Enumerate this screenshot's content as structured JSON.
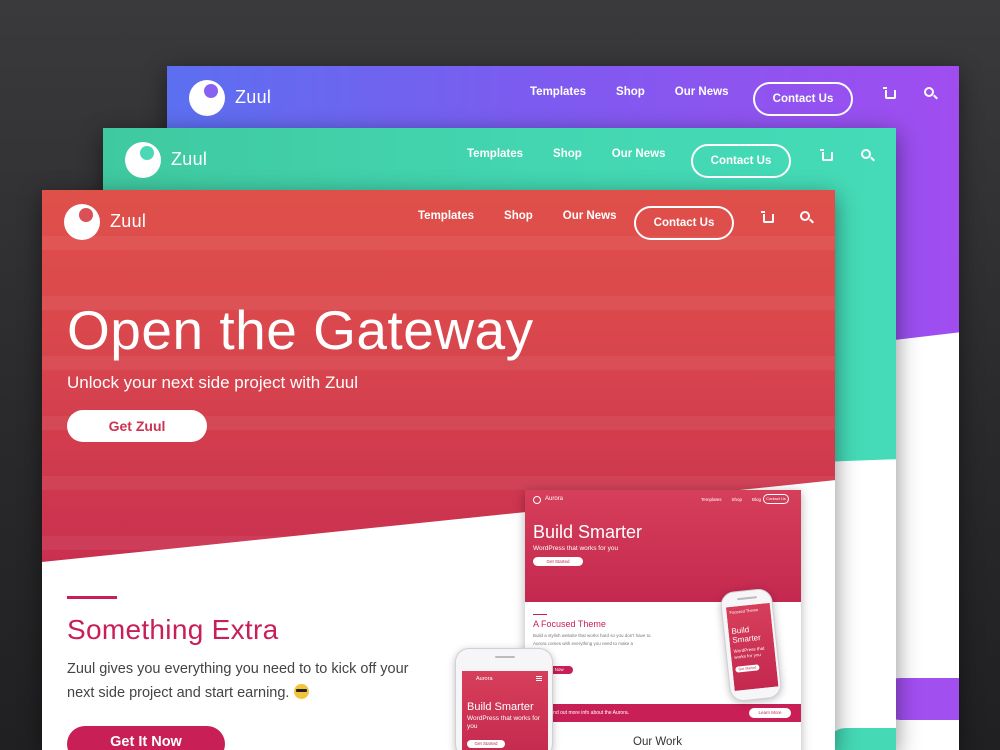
{
  "cards": {
    "purple": {
      "brand": "Zuul",
      "nav": [
        "Templates",
        "Shop",
        "Our News"
      ],
      "contact": "Contact Us",
      "accent": "#7f5af0"
    },
    "green": {
      "brand": "Zuul",
      "nav": [
        "Templates",
        "Shop",
        "Our News"
      ],
      "contact": "Contact Us",
      "accent": "#43d6b1"
    },
    "red": {
      "brand": "Zuul",
      "nav": [
        "Templates",
        "Shop",
        "Our News"
      ],
      "contact": "Contact Us",
      "accent": "#c81f56",
      "hero_title": "Open the Gateway",
      "hero_subtitle": "Unlock your next side project with Zuul",
      "hero_button": "Get Zuul",
      "section_title": "Something Extra",
      "section_text": "Zuul gives you everything you need to to kick off your next side project and start earning.",
      "cta_button": "Get It Now"
    }
  },
  "icons": {
    "cart": "cart-icon",
    "search": "search-icon",
    "emoji": "sunglasses-emoji-icon",
    "logo": "zuul-logo-icon"
  },
  "mockup": {
    "brand": "Aurora",
    "nav": [
      "Templates",
      "Shop",
      "Blog"
    ],
    "contact": "Contact Us",
    "hero_title": "Build Smarter",
    "hero_subtitle": "WordPress that works for you",
    "hero_button": "Get Started",
    "section_title": "A Focused Theme",
    "section_text": "Build a stylish website that works hard so you don't have to. Aurora comes with everything you need to make a",
    "section_button": "Get It Now",
    "bar_text": "Find out more info about the Aurora.",
    "bar_button": "Learn More",
    "work_title": "Our Work"
  },
  "phone_small": {
    "brand": "Aurora",
    "title": "Build Smarter",
    "subtitle": "WordPress that works for you",
    "button": "Get Started"
  },
  "phone_large": {
    "brand": "Focused Theme",
    "title": "Build Smarter",
    "subtitle": "WordPress that works for you",
    "button": "Get Started"
  }
}
